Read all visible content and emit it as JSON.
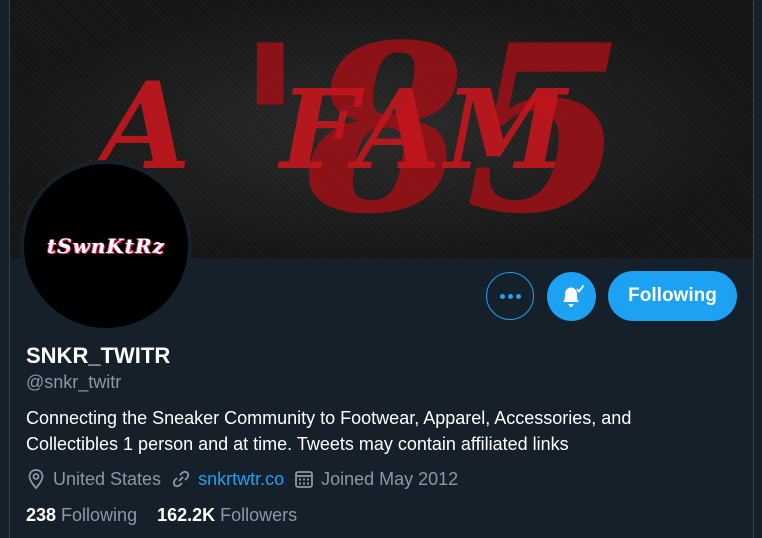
{
  "banner": {
    "text_left": "A",
    "text_middle": "FAM",
    "text_number": "'85"
  },
  "avatar": {
    "logo_text": "tSwnKtRz"
  },
  "actions": {
    "more_icon": "more-icon",
    "bell_icon": "bell-check-icon",
    "following_label": "Following"
  },
  "profile": {
    "display_name": "SNKR_TWITR",
    "handle": "@snkr_twitr",
    "bio": "Connecting the Sneaker Community to Footwear, Apparel, Accessories, and Collectibles 1 person and at time. Tweets may contain affiliated links",
    "location": "United States",
    "website": "snkrtwtr.co",
    "joined": "Joined May 2012"
  },
  "stats": {
    "following_count": "238",
    "following_label": "Following",
    "followers_count": "162.2K",
    "followers_label": "Followers"
  },
  "colors": {
    "background": "#15202b",
    "accent": "#1da1f2",
    "secondary_text": "#8899a6",
    "banner_red": "#b3141b"
  }
}
